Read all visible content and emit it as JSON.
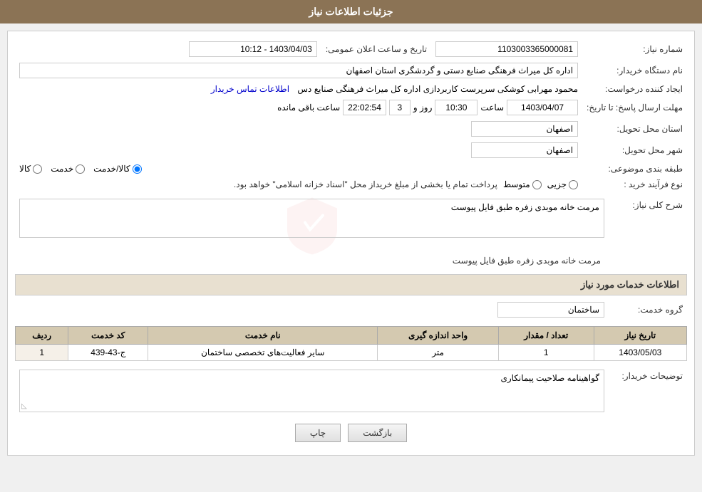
{
  "header": {
    "title": "جزئیات اطلاعات نیاز"
  },
  "fields": {
    "shomara_niaz_label": "شماره نیاز:",
    "shomara_niaz_value": "1103003365000081",
    "nam_dastgah_label": "نام دستگاه خریدار:",
    "nam_dastgah_value": "اداره کل میراث فرهنگی  صنایع دستی و گردشگری استان اصفهان",
    "ijad_label": "ایجاد کننده درخواست:",
    "ijad_value": "محمود مهرابی کوشکی سرپرست کاربردازی اداره کل میراث فرهنگی  صنایع دس",
    "ijad_link": "اطلاعات تماس خریدار",
    "mohlat_label": "مهلت ارسال پاسخ: تا تاریخ:",
    "mohlat_date": "1403/04/07",
    "mohlat_saat_label": "ساعت",
    "mohlat_saat": "10:30",
    "mohlat_rooz_label": "روز و",
    "mohlat_rooz": "3",
    "mohlat_countdown": "22:02:54",
    "mohlat_remaining": "ساعت باقی مانده",
    "ostan_tahvil_label": "استان محل تحویل:",
    "ostan_tahvil_value": "اصفهان",
    "shahr_tahvil_label": "شهر محل تحویل:",
    "shahr_tahvil_value": "اصفهان",
    "tabaqe_label": "طبقه بندی موضوعی:",
    "tabaqe_kala": "کالا",
    "tabaqe_khedmat": "خدمت",
    "tabaqe_kala_khedmat": "کالا/خدمت",
    "tabaqe_selected": "kala_khedmat",
    "tarikh_label": "تاریخ و ساعت اعلان عمومی:",
    "tarikh_value": "1403/04/03 - 10:12",
    "nooe_farayand_label": "نوع فرآیند خرید :",
    "nooe_jozi": "جزیی",
    "nooe_motavaset": "متوسط",
    "nooe_desc": "پرداخت تمام یا بخشی از مبلغ خریداز محل \"اسناد خزانه اسلامی\" خواهد بود.",
    "sharh_label": "شرح کلی نیاز:",
    "sharh_value": "مرمت خانه موبدی زفره طبق فایل پیوست",
    "services_section_label": "اطلاعات خدمات مورد نیاز",
    "grooh_label": "گروه خدمت:",
    "grooh_value": "ساختمان",
    "table_headers": [
      "ردیف",
      "کد خدمت",
      "نام خدمت",
      "واحد اندازه گیری",
      "تعداد / مقدار",
      "تاریخ نیاز"
    ],
    "table_rows": [
      {
        "radif": "1",
        "kod_khedmat": "ج-43-439",
        "nam_khedmat": "سایر فعالیت‌های تخصصی ساختمان",
        "vahed": "متر",
        "tedad": "1",
        "tarikh_niaz": "1403/05/03"
      }
    ],
    "tozihat_label": "توضیحات خریدار:",
    "tozihat_value": "گواهینامه صلاحیت پیمانکاری"
  },
  "buttons": {
    "print_label": "چاپ",
    "back_label": "بازگشت"
  }
}
